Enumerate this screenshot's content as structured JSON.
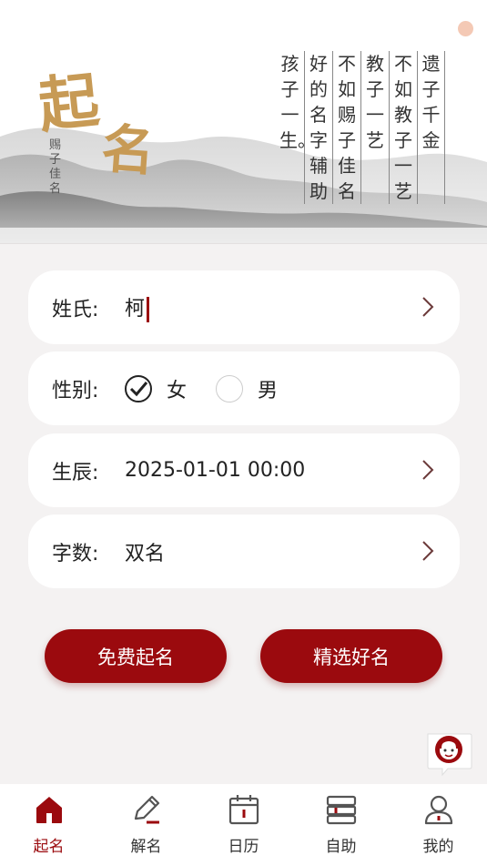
{
  "banner": {
    "title_char1": "起",
    "title_char2": "名",
    "subtitle": "赐子佳名",
    "poem_columns": [
      "遗子千金",
      "不如教子一艺",
      "教子一艺",
      "不如赐子佳名",
      "好的名字辅助",
      "孩子一生。"
    ]
  },
  "form": {
    "surname": {
      "label": "姓氏:",
      "value": "柯"
    },
    "gender": {
      "label": "性别:",
      "options": [
        "女",
        "男"
      ],
      "selected": "女"
    },
    "birth": {
      "label": "生辰:",
      "value": "2025-01-01 00:00"
    },
    "count": {
      "label": "字数:",
      "value": "双名"
    }
  },
  "actions": {
    "free_label": "免费起名",
    "select_label": "精选好名"
  },
  "tabs": [
    {
      "label": "起名",
      "icon": "home-icon",
      "active": true
    },
    {
      "label": "解名",
      "icon": "pencil-icon"
    },
    {
      "label": "日历",
      "icon": "calendar-icon"
    },
    {
      "label": "自助",
      "icon": "self-service-icon"
    },
    {
      "label": "我的",
      "icon": "user-icon"
    }
  ],
  "colors": {
    "accent": "#9b0a0e",
    "title_gold": "#c79a55",
    "background": "#f4f2f2"
  }
}
